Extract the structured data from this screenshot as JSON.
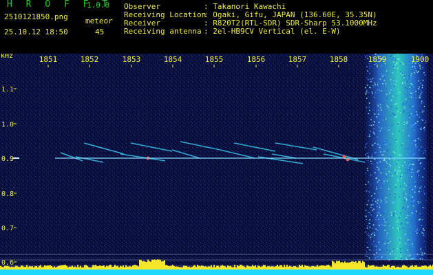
{
  "header": {
    "brand": "H R O F F T",
    "version": "1.0.0",
    "filename": "2510121850.png",
    "meteor_label": "meteor",
    "datetime": "25.10.12 18:50",
    "meteor_count": "45",
    "info": [
      {
        "label": "Observer",
        "value": ": Takanori Kawachi"
      },
      {
        "label": "Receiving Location",
        "value": ": Ogaki, Gifu, JAPAN (136.60E, 35.35N)"
      },
      {
        "label": "Receiver",
        "value": ": R820T2(RTL-SDR) SDR-Sharp 53.1000MHz"
      },
      {
        "label": "Receiving antenna",
        "value": ": 2el-HB9CV Vertical (el. E-W)"
      }
    ]
  },
  "spectrogram": {
    "y_unit": "kHz",
    "y_ticks": [
      "1.1",
      "1.0",
      "0.9",
      "0.8",
      "0.7",
      "0.6"
    ],
    "time_ticks": [
      "1851",
      "1852",
      "1853",
      "1854",
      "1855",
      "1856",
      "1857",
      "1858",
      "1859",
      "1900"
    ],
    "colors": {
      "background": "#0a0f3a",
      "carrier": "#7fd8ff",
      "tick_labels": "#f2ef3a",
      "amplitude": "#f5e62a",
      "baseline": "#20d8ff"
    }
  }
}
